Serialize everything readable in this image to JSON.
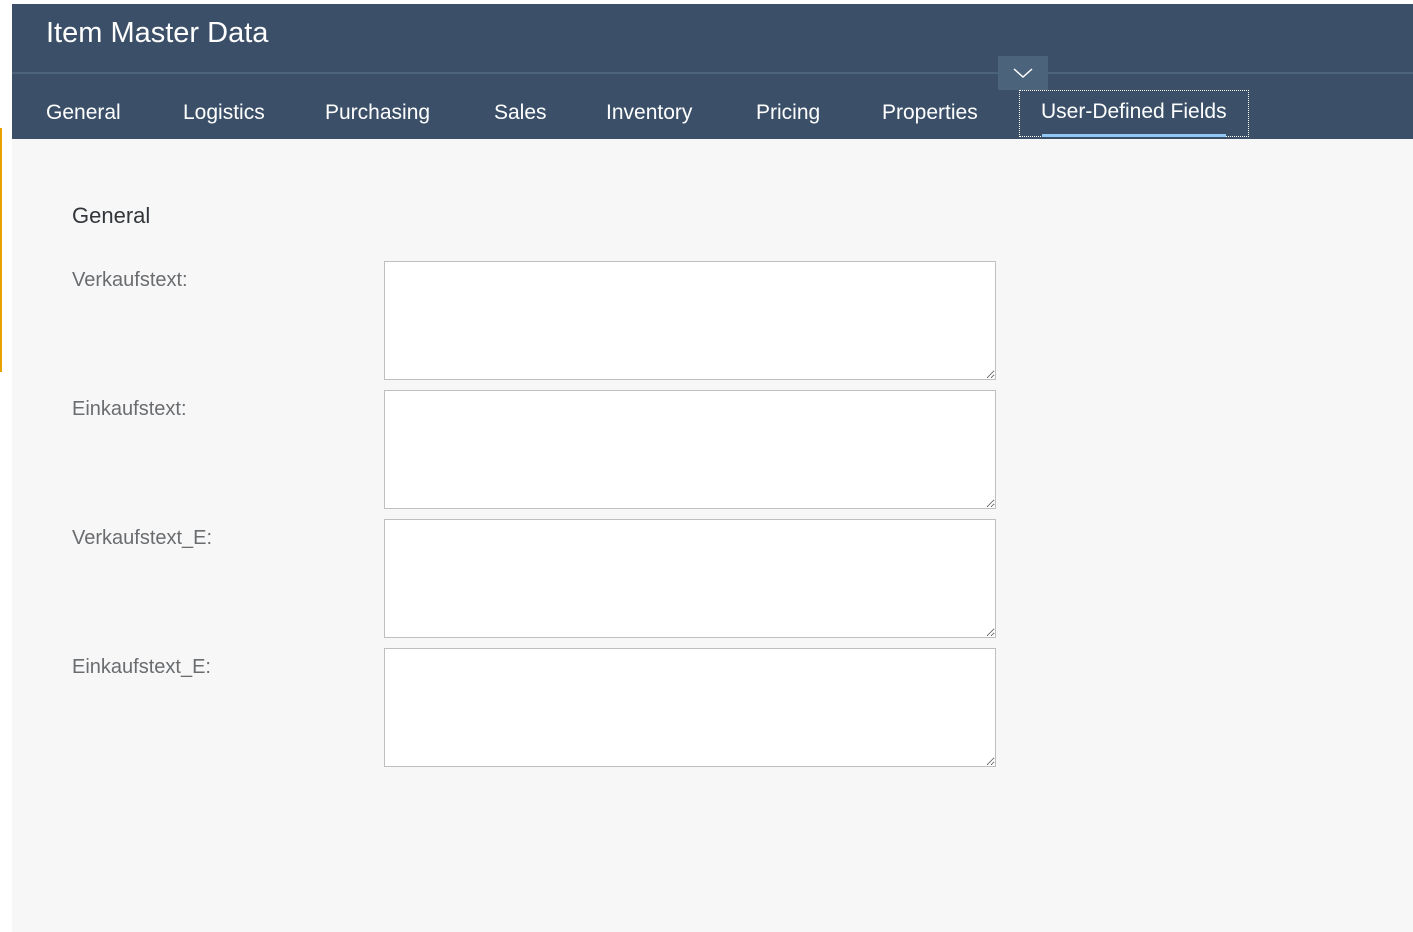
{
  "window": {
    "title": "Item Master Data"
  },
  "header": {
    "collapse_icon": "chevron-down-icon"
  },
  "tabs": [
    {
      "label": "General",
      "active": false
    },
    {
      "label": "Logistics",
      "active": false
    },
    {
      "label": "Purchasing",
      "active": false
    },
    {
      "label": "Sales",
      "active": false
    },
    {
      "label": "Inventory",
      "active": false
    },
    {
      "label": "Pricing",
      "active": false
    },
    {
      "label": "Properties",
      "active": false
    },
    {
      "label": "User-Defined Fields",
      "active": true
    }
  ],
  "section": {
    "title": "General"
  },
  "fields": [
    {
      "label": "Verkaufstext:",
      "value": ""
    },
    {
      "label": "Einkaufstext:",
      "value": ""
    },
    {
      "label": "Verkaufstext_E:",
      "value": ""
    },
    {
      "label": "Einkaufstext_E:",
      "value": ""
    }
  ],
  "colors": {
    "header_bg": "#3b5068",
    "content_bg": "#f7f7f7",
    "active_tab_underline": "#91c8f6",
    "left_accent": "#e8a300"
  }
}
